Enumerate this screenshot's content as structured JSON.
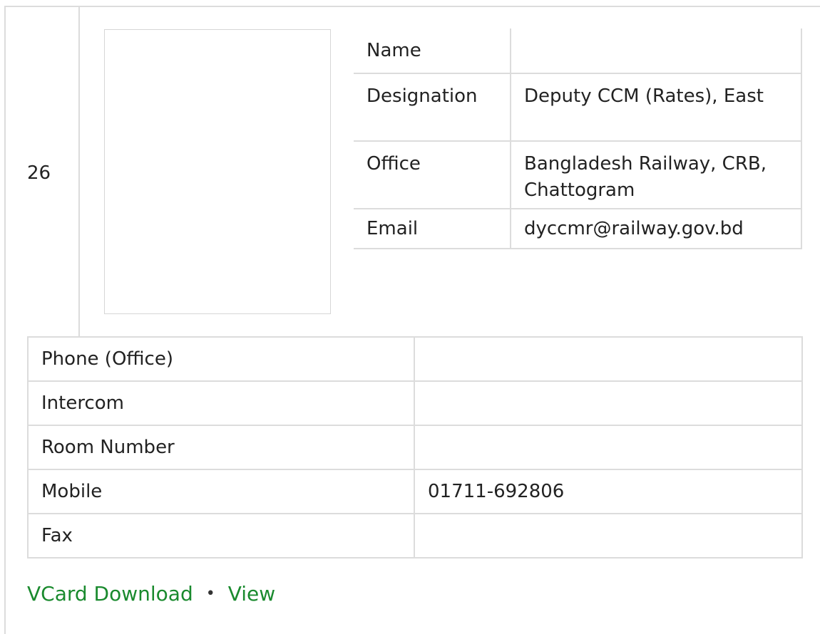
{
  "entry": {
    "serial": "26",
    "info": {
      "name_label": "Name",
      "name_value": "",
      "designation_label": "Designation",
      "designation_value": "Deputy CCM (Rates), East",
      "office_label": "Office",
      "office_value": "Bangladesh Railway, CRB, Chattogram",
      "email_label": "Email",
      "email_value": "dyccmr@railway.gov.bd"
    },
    "contact": {
      "phone_label": "Phone (Office)",
      "phone_value": "",
      "intercom_label": "Intercom",
      "intercom_value": "",
      "room_label": "Room Number",
      "room_value": "",
      "mobile_label": "Mobile",
      "mobile_value": "01711-692806",
      "fax_label": "Fax",
      "fax_value": ""
    },
    "links": {
      "vcard_label": "VCard Download",
      "separator": "•",
      "view_label": "View"
    }
  },
  "colors": {
    "link": "#1a8a2e",
    "border": "#dcdcdc",
    "text": "#222222"
  }
}
